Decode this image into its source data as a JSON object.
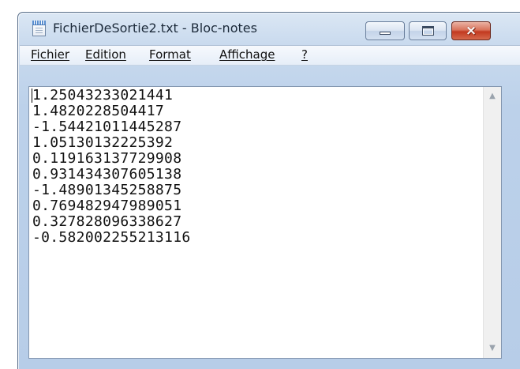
{
  "window": {
    "title": "FichierDeSortie2.txt - Bloc-notes",
    "icon": "notepad-icon",
    "controls": {
      "minimize": "minimize-icon",
      "maximize": "maximize-icon",
      "close": "×"
    }
  },
  "menu": {
    "items": [
      {
        "label": "Fichier"
      },
      {
        "label": "Edition"
      },
      {
        "label": "Format"
      },
      {
        "label": "Affichage"
      },
      {
        "label": "?"
      }
    ]
  },
  "editor": {
    "lines": [
      "1.25043233021441",
      "1.4820228504417",
      "-1.54421011445287",
      "1.05130132225392",
      "0.119163137729908",
      "0.931434307605138",
      "-1.48901345258875",
      "0.769482947989051",
      "0.327828096338627",
      "-0.582002255213116"
    ]
  },
  "scrollbar": {
    "up": "▲",
    "down": "▼"
  },
  "colors": {
    "frame": "#bcd1ea",
    "close_button": "#c2391f",
    "editor_bg": "#ffffff"
  }
}
